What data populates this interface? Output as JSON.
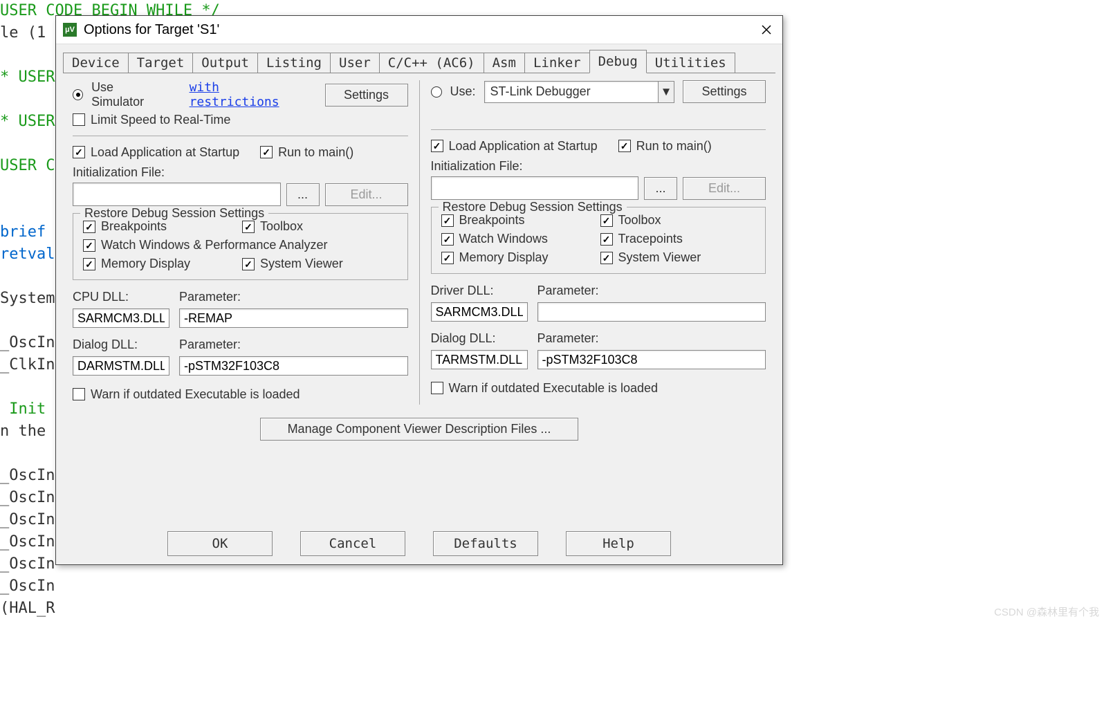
{
  "code_lines": [
    {
      "cls": "g",
      "text": "USER CODE BEGIN WHILE */"
    },
    {
      "cls": "",
      "text": "le (1"
    },
    {
      "cls": "",
      "text": ""
    },
    {
      "cls": "g",
      "text": "* USER"
    },
    {
      "cls": "",
      "text": ""
    },
    {
      "cls": "g",
      "text": "* USER"
    },
    {
      "cls": "",
      "text": ""
    },
    {
      "cls": "g",
      "text": "USER C"
    },
    {
      "cls": "",
      "text": ""
    },
    {
      "cls": "",
      "text": ""
    },
    {
      "cls": "b",
      "text": "brief"
    },
    {
      "cls": "b",
      "text": "retval"
    },
    {
      "cls": "",
      "text": ""
    },
    {
      "cls": "",
      "text": "System"
    },
    {
      "cls": "",
      "text": ""
    },
    {
      "cls": "",
      "text": "_OscIn"
    },
    {
      "cls": "",
      "text": "_ClkIn"
    },
    {
      "cls": "",
      "text": ""
    },
    {
      "cls": "g",
      "text": " Init"
    },
    {
      "cls": "",
      "text": "n the"
    },
    {
      "cls": "",
      "text": ""
    },
    {
      "cls": "",
      "text": "_OscIn"
    },
    {
      "cls": "",
      "text": "_OscIn"
    },
    {
      "cls": "",
      "text": "_OscIn"
    },
    {
      "cls": "",
      "text": "_OscIn"
    },
    {
      "cls": "",
      "text": "_OscIn"
    },
    {
      "cls": "",
      "text": "_OscIn"
    },
    {
      "cls": "",
      "text": "(HAL_R"
    }
  ],
  "dialog": {
    "title": "Options for Target 'S1'",
    "tabs": [
      "Device",
      "Target",
      "Output",
      "Listing",
      "User",
      "C/C++ (AC6)",
      "Asm",
      "Linker",
      "Debug",
      "Utilities"
    ],
    "active_tab": 8,
    "left": {
      "use_sim": "Use Simulator",
      "restrictions": "with restrictions",
      "settings": "Settings",
      "limit": "Limit Speed to Real-Time",
      "load_app": "Load Application at Startup",
      "run_main": "Run to main()",
      "init_file": "Initialization File:",
      "browse": "...",
      "edit": "Edit...",
      "restore_title": "Restore Debug Session Settings",
      "bp": "Breakpoints",
      "toolbox": "Toolbox",
      "watch": "Watch Windows & Performance Analyzer",
      "mem": "Memory Display",
      "sysv": "System Viewer",
      "cpu_dll_l": "CPU DLL:",
      "param_l": "Parameter:",
      "cpu_dll_v": "SARMCM3.DLL",
      "cpu_param_v": "-REMAP",
      "dlg_dll_l": "Dialog DLL:",
      "dlg_dll_v": "DARMSTM.DLL",
      "dlg_param_v": "-pSTM32F103C8",
      "warn": "Warn if outdated Executable is loaded"
    },
    "right": {
      "use": "Use:",
      "debugger": "ST-Link Debugger",
      "settings": "Settings",
      "load_app": "Load Application at Startup",
      "run_main": "Run to main()",
      "init_file": "Initialization File:",
      "browse": "...",
      "edit": "Edit...",
      "restore_title": "Restore Debug Session Settings",
      "bp": "Breakpoints",
      "toolbox": "Toolbox",
      "watch": "Watch Windows",
      "trace": "Tracepoints",
      "mem": "Memory Display",
      "sysv": "System Viewer",
      "drv_dll_l": "Driver DLL:",
      "param_l": "Parameter:",
      "drv_dll_v": "SARMCM3.DLL",
      "drv_param_v": "",
      "dlg_dll_l": "Dialog DLL:",
      "dlg_dll_v": "TARMSTM.DLL",
      "dlg_param_v": "-pSTM32F103C8",
      "warn": "Warn if outdated Executable is loaded"
    },
    "manage_btn": "Manage Component Viewer Description Files ...",
    "footer": {
      "ok": "OK",
      "cancel": "Cancel",
      "defaults": "Defaults",
      "help": "Help"
    }
  },
  "watermark": "CSDN @森林里有个我"
}
